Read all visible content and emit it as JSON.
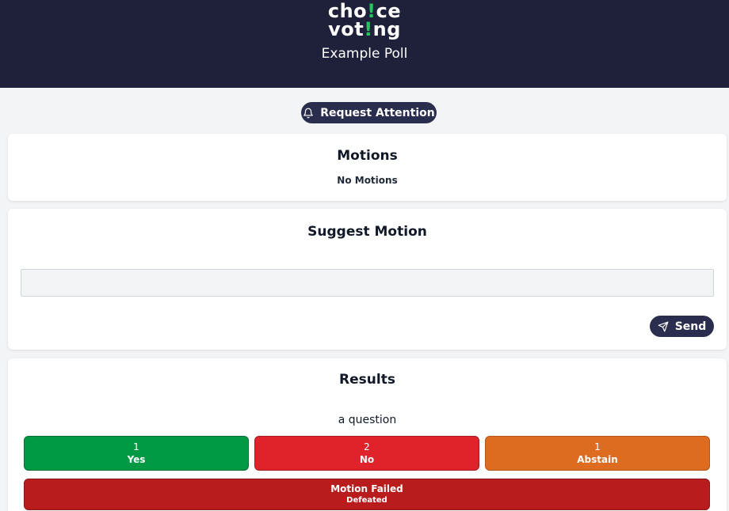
{
  "header": {
    "logo": {
      "line1_a": "cho",
      "line1_bang": "!",
      "line1_b": "ce",
      "line2_a": "vot",
      "line2_bang": "!",
      "line2_b": "ng"
    },
    "poll_title": "Example Poll"
  },
  "request_attention": {
    "label": "Request Attention",
    "icon": "bell-icon"
  },
  "motions": {
    "title": "Motions",
    "empty_text": "No Motions"
  },
  "suggest": {
    "title": "Suggest Motion",
    "input_value": "",
    "input_placeholder": "",
    "send_label": "Send",
    "send_icon": "send-icon"
  },
  "results": {
    "title": "Results",
    "question": "a question",
    "votes": [
      {
        "count": "1",
        "label": "Yes",
        "color": "#009a44"
      },
      {
        "count": "2",
        "label": "No",
        "color": "#e0222b"
      },
      {
        "count": "1",
        "label": "Abstain",
        "color": "#dd6b20"
      }
    ],
    "outcome": {
      "main": "Motion Failed",
      "sub": "Defeated",
      "color": "#b91c1c"
    }
  },
  "colors": {
    "header_bg": "#1e2139",
    "accent": "#2a2d4e",
    "logo_bang": "#22c55e"
  }
}
